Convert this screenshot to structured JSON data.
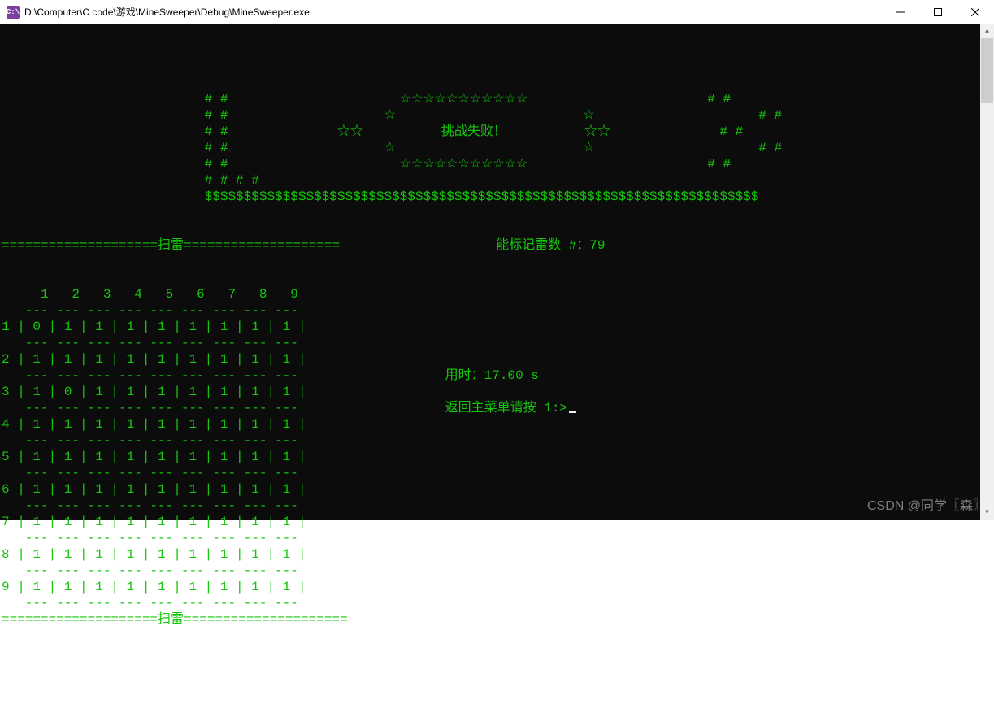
{
  "window": {
    "title": "D:\\Computer\\C code\\游戏\\MineSweeper\\Debug\\MineSweeper.exe",
    "icon_label": "C:\\"
  },
  "banner": {
    "hash_col": "#",
    "stars_top": "☆☆☆☆☆☆☆☆☆☆☆",
    "star_frame_l": "☆",
    "star_frame_r": "☆",
    "stars_mid_l": "☆☆",
    "title": "挑战失败！",
    "stars_mid_r": "☆☆",
    "stars_bot": "☆☆☆☆☆☆☆☆☆☆☆",
    "dollar_line": "$$$$$$$$$$$$$$$$$$$$$$$$$$$$$$$$$$$$$$$$$$$$$$$$$$$$$$$$$$$$$$$$$$$$$$$",
    "remaining_label": "能标记雷数 #：",
    "remaining_value": "79"
  },
  "grid": {
    "title": "扫雷",
    "eq_line_left": "====================",
    "eq_line_right": "====================",
    "cols": [
      " 1",
      " 2",
      " 3",
      " 4",
      " 5",
      " 6",
      " 7",
      " 8",
      " 9"
    ],
    "row_labels": [
      "1",
      "2",
      "3",
      "4",
      "5",
      "6",
      "7",
      "8",
      "9"
    ],
    "cells": [
      [
        "0",
        "1",
        "1",
        "1",
        "1",
        "1",
        "1",
        "1",
        "1"
      ],
      [
        "1",
        "1",
        "1",
        "1",
        "1",
        "1",
        "1",
        "1",
        "1"
      ],
      [
        "1",
        "0",
        "1",
        "1",
        "1",
        "1",
        "1",
        "1",
        "1"
      ],
      [
        "1",
        "1",
        "1",
        "1",
        "1",
        "1",
        "1",
        "1",
        "1"
      ],
      [
        "1",
        "1",
        "1",
        "1",
        "1",
        "1",
        "1",
        "1",
        "1"
      ],
      [
        "1",
        "1",
        "1",
        "1",
        "1",
        "1",
        "1",
        "1",
        "1"
      ],
      [
        "1",
        "1",
        "1",
        "1",
        "1",
        "1",
        "1",
        "1",
        "1"
      ],
      [
        "1",
        "1",
        "1",
        "1",
        "1",
        "1",
        "1",
        "1",
        "1"
      ],
      [
        "1",
        "1",
        "1",
        "1",
        "1",
        "1",
        "1",
        "1",
        "1"
      ]
    ],
    "row_sep": "   --- --- --- --- --- --- --- --- ---",
    "footer": "============================================="
  },
  "info": {
    "time_label": "用时：",
    "time_value": "17.00 s",
    "prompt": "返回主菜单请按 1:>"
  },
  "watermark": "CSDN @同学〖森〗"
}
